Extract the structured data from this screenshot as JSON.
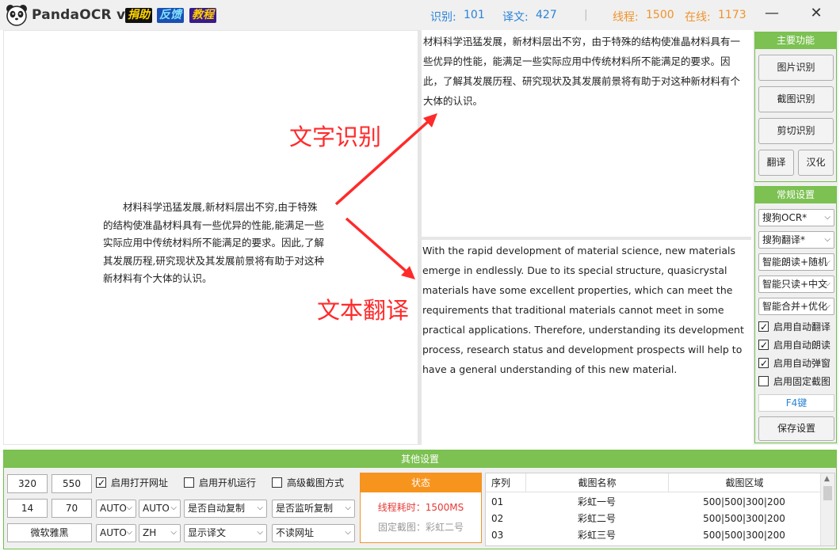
{
  "app": {
    "title": "PandaOCR v2.5",
    "badges": [
      "捐助",
      "反馈",
      "教程"
    ],
    "stats": {
      "ocr_label": "识别:",
      "ocr_count": "101",
      "trans_label": "译文:",
      "trans_count": "427",
      "sep": "|",
      "threads_label": "线程:",
      "threads_count": "1500",
      "online_label": "在线:",
      "online_count": "1173"
    },
    "window_controls": {
      "minimize": "—",
      "close": "✕"
    }
  },
  "left_pane": {
    "text": "材料科学迅猛发展,新材料层出不穷,由于特殊的结构使准晶材料具有一些优异的性能,能满足一些实际应用中传统材料所不能满足的要求。因此,了解其发展历程,研究现状及其发展前景将有助于对这种新材料有个大体的认识。"
  },
  "ocr_result": {
    "text": "材料科学迅猛发展，新材料层出不穷，由于特殊的结构使准晶材料具有一些优异的性能，能满足一些实际应用中传统材料所不能满足的要求。因此，了解其发展历程、研究现状及其发展前景将有助于对这种新材料有个大体的认识。"
  },
  "translation_result": {
    "text": "With the rapid development of material science, new materials emerge in endlessly. Due to its special structure, quasicrystal materials have some excellent properties, which can meet the requirements that traditional materials cannot meet in some practical applications.  Therefore, understanding its development process, research status and development prospects will help to have a general understanding of this new material."
  },
  "annotations": {
    "ocr": "文字识别",
    "translate": "文本翻译"
  },
  "sidebar": {
    "main_title": "主要功能",
    "image_ocr": "图片识别",
    "screenshot_ocr": "截图识别",
    "clipboard_ocr": "剪切识别",
    "translate": "翻译",
    "localize": "汉化",
    "settings_title": "常规设置",
    "selects": [
      "搜狗OCR*",
      "搜狗翻译*",
      "智能朗读+随机",
      "智能只读+中文",
      "智能合并+优化"
    ],
    "checks": [
      {
        "label": "启用自动翻译",
        "checked": true
      },
      {
        "label": "启用自动朗读",
        "checked": true
      },
      {
        "label": "启用自动弹窗",
        "checked": true
      },
      {
        "label": "启用固定截图",
        "checked": false
      }
    ],
    "hotkey": "F4键",
    "save": "保存设置"
  },
  "bottom": {
    "title": "其他设置",
    "width": "320",
    "height": "550",
    "x": "14",
    "y": "70",
    "font": "微软雅黑",
    "selects": {
      "lang1": "AUTO",
      "lang2": "AUTO",
      "lang3": "AUTO",
      "lang4": "ZH",
      "copy_auto": "是否自动复制",
      "monitor_copy": "是否监听复制",
      "show_trans": "显示译文",
      "no_read_url": "不读网址"
    },
    "checks": [
      {
        "label": "启用打开网址",
        "checked": true
      },
      {
        "label": "启用开机运行",
        "checked": false
      },
      {
        "label": "高级截图方式",
        "checked": false
      }
    ],
    "status": {
      "title": "状态",
      "time": "线程耗时：1500MS",
      "fixed": "固定截图：彩虹二号"
    },
    "table": {
      "headers": [
        "序列",
        "截图名称",
        "截图区域"
      ],
      "rows": [
        [
          "01",
          "彩虹一号",
          "500|500|300|200"
        ],
        [
          "02",
          "彩虹二号",
          "500|500|300|200"
        ],
        [
          "03",
          "彩虹三号",
          "500|500|300|200"
        ]
      ]
    }
  },
  "colors": {
    "accent_green": "#7cc152",
    "stat_blue": "#2a83d8",
    "stat_orange": "#f0932b",
    "annotation_red": "#ff2a2a"
  }
}
